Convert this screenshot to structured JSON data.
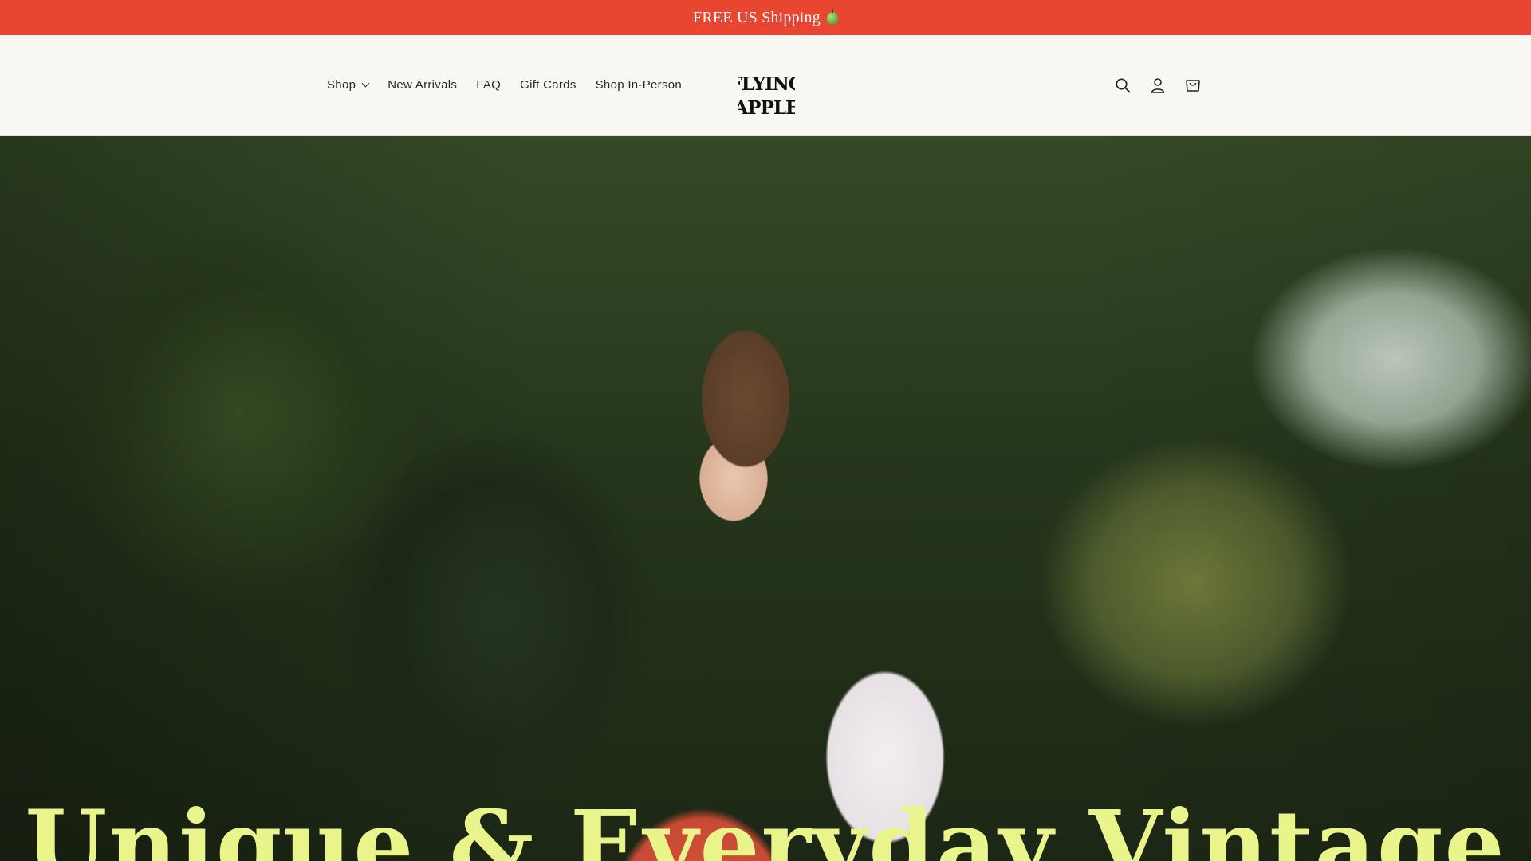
{
  "announcement": {
    "text": "FREE US Shipping",
    "emoji": "green-apple"
  },
  "header": {
    "nav": [
      {
        "label": "Shop",
        "has_dropdown": true
      },
      {
        "label": "New Arrivals"
      },
      {
        "label": "FAQ"
      },
      {
        "label": "Gift Cards"
      },
      {
        "label": "Shop In-Person"
      }
    ],
    "logo": {
      "line1": "FLYING",
      "line2": "APPLE"
    },
    "icons": [
      "search-icon",
      "account-icon",
      "cart-icon"
    ]
  },
  "hero": {
    "heading": "Unique & Everyday Vintage"
  },
  "colors": {
    "announcement_bg": "#e84630",
    "header_bg": "#f8f7f3",
    "hero_heading": "#e9f58a"
  }
}
